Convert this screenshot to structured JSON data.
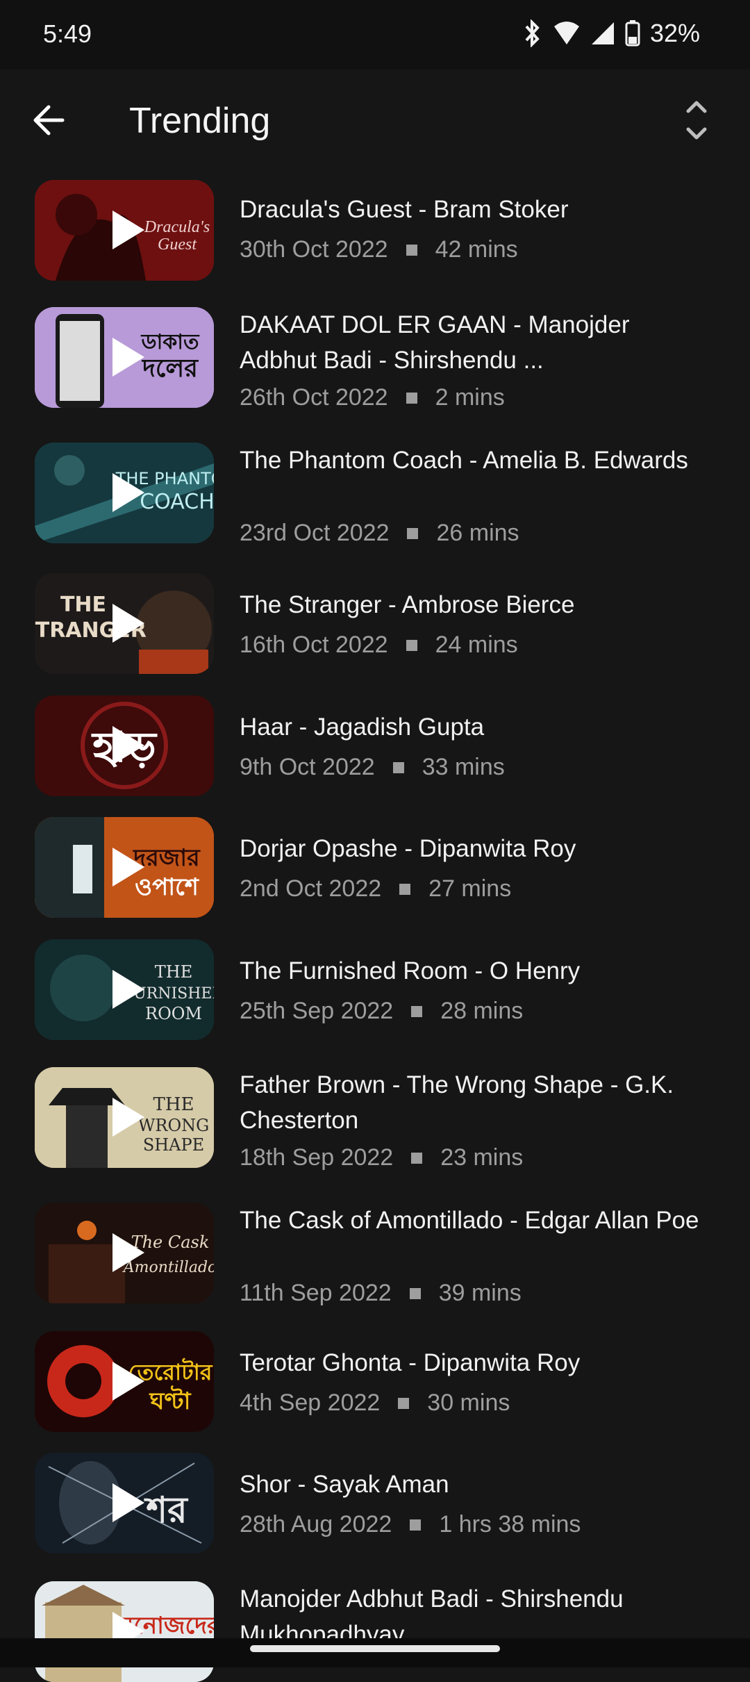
{
  "status": {
    "time": "5:49",
    "battery": "32%"
  },
  "header": {
    "title": "Trending",
    "back_icon": "arrow-back-icon",
    "sort_icon": "unfold-more-icon"
  },
  "items": [
    {
      "title": "Dracula's Guest - Bram Stoker",
      "date": "30th Oct 2022",
      "duration": "42 mins",
      "color": "#7a1412"
    },
    {
      "title": "DAKAAT DOL ER GAAN - Manojder Adbhut Badi - Shirshendu ...",
      "date": "26th Oct 2022",
      "duration": "2 mins",
      "color": "#b59ad8"
    },
    {
      "title": "The Phantom Coach - Amelia B. Edwards",
      "date": "23rd Oct 2022",
      "duration": "26 mins",
      "color": "#1e4e54"
    },
    {
      "title": "The Stranger - Ambrose Bierce",
      "date": "16th Oct 2022",
      "duration": "24 mins",
      "color": "#2a2220"
    },
    {
      "title": "Haar - Jagadish Gupta",
      "date": "9th Oct 2022",
      "duration": "33 mins",
      "color": "#4a0c0c"
    },
    {
      "title": "Dorjar Opashe - Dipanwita Roy",
      "date": "2nd Oct 2022",
      "duration": "27 mins",
      "color": "#c2501c"
    },
    {
      "title": "The Furnished Room - O Henry",
      "date": "25th Sep 2022",
      "duration": "28 mins",
      "color": "#173637"
    },
    {
      "title": "Father Brown - The Wrong Shape - G.K. Chesterton",
      "date": "18th Sep 2022",
      "duration": "23 mins",
      "color": "#cfc4a2"
    },
    {
      "title": "The Cask of Amontillado - Edgar Allan Poe",
      "date": "11th Sep 2022",
      "duration": "39 mins",
      "color": "#2a1410"
    },
    {
      "title": "Terotar Ghonta - Dipanwita Roy",
      "date": "4th Sep 2022",
      "duration": "30 mins",
      "color": "#2a0808"
    },
    {
      "title": "Shor - Sayak Aman",
      "date": "28th Aug 2022",
      "duration": "1 hrs 38 mins",
      "color": "#1a2430"
    },
    {
      "title": "Manojder Adbhut Badi - Shirshendu Mukhopadhyay",
      "date": "",
      "duration": "",
      "color": "#dfe6e8"
    }
  ]
}
